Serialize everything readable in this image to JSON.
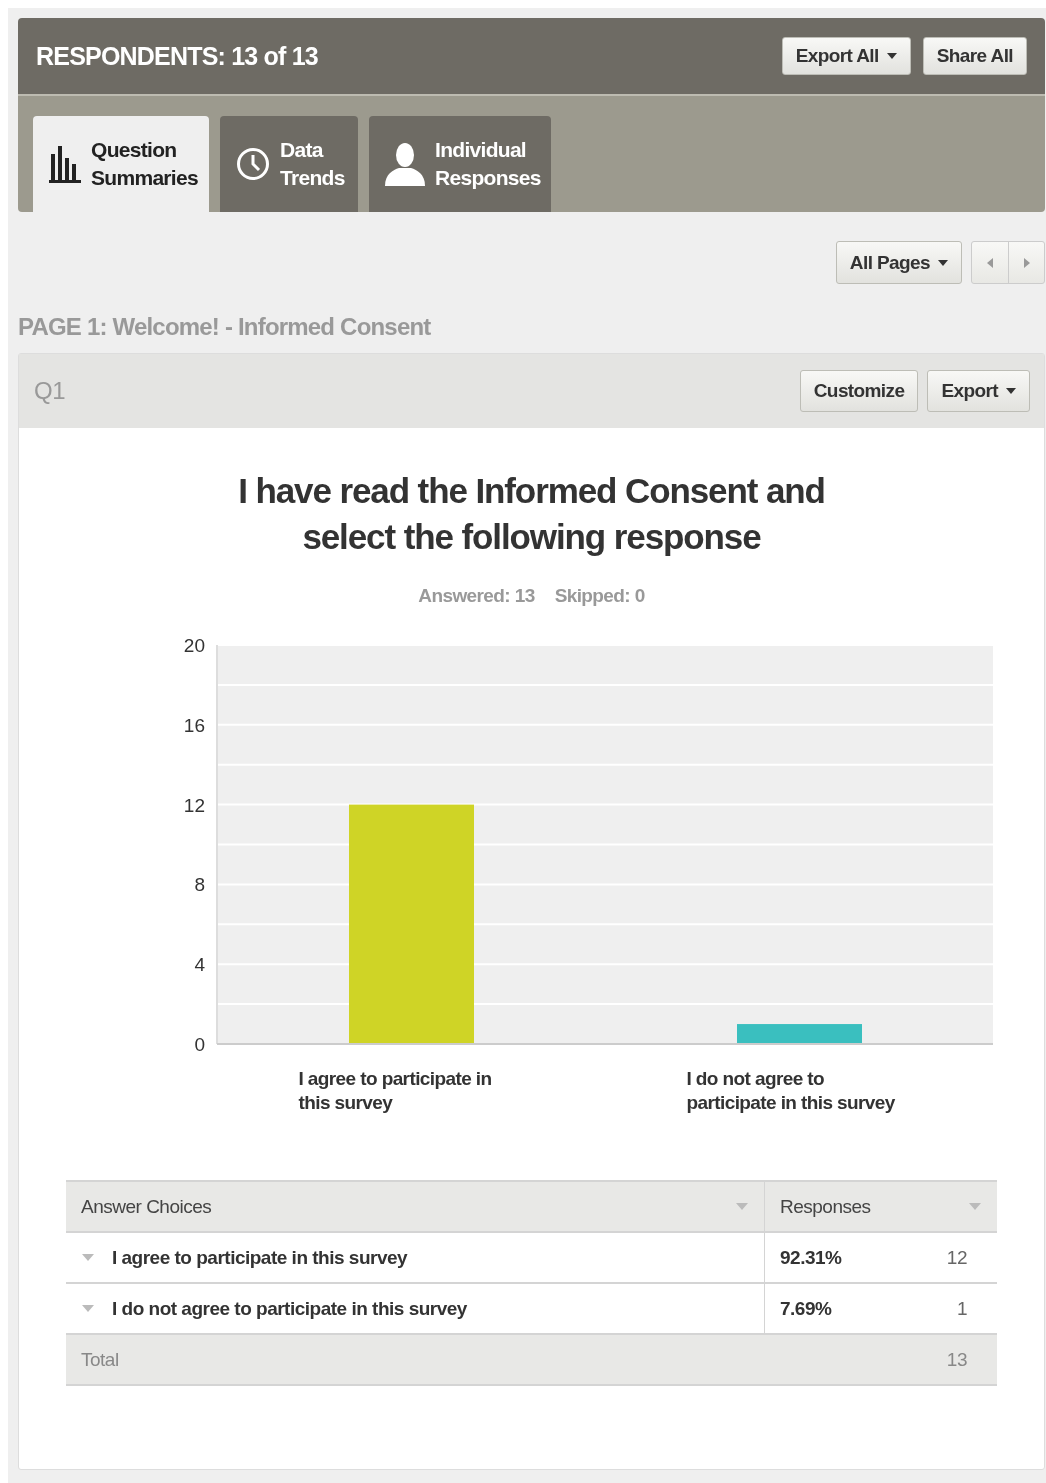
{
  "header": {
    "title": "RESPONDENTS: 13 of 13",
    "buttons": [
      {
        "label": "Export All",
        "dropdown": true
      },
      {
        "label": "Share All",
        "dropdown": false
      }
    ]
  },
  "tabs": [
    {
      "label": "Question Summaries",
      "kind": "bars",
      "selected": true
    },
    {
      "label": "Data Trends",
      "kind": "clock",
      "selected": false
    },
    {
      "label": "Individual Responses",
      "kind": "person",
      "selected": false
    }
  ],
  "pager": {
    "filter": "All Pages"
  },
  "page_title": "PAGE 1: Welcome! - Informed Consent",
  "question": {
    "number": "Q1",
    "buttons": [
      {
        "label": "Customize",
        "dropdown": false
      },
      {
        "label": "Export",
        "dropdown": true
      }
    ],
    "title": "I have read the Informed Consent and select the following response",
    "answered": "Answered: 13",
    "skipped": "Skipped: 0",
    "chart_data": {
      "type": "bar",
      "categories": [
        "I agree to participate in this survey",
        "I do not agree to participate in this survey"
      ],
      "values": [
        12,
        1
      ],
      "grid": true,
      "colors": [
        "#cfd426",
        "#3abfbf"
      ],
      "ylim": [
        0,
        20
      ],
      "yticks": [
        0,
        4,
        8,
        12,
        16,
        20
      ]
    },
    "table": {
      "columns": [
        "Answer Choices",
        "Responses"
      ],
      "rows": [
        {
          "choice": "I agree to participate in this survey",
          "percent": "92.31%",
          "count": "12"
        },
        {
          "choice": "I do not agree to participate in this survey",
          "percent": "7.69%",
          "count": "1"
        }
      ],
      "total": {
        "label": "Total",
        "count": "13"
      }
    }
  }
}
